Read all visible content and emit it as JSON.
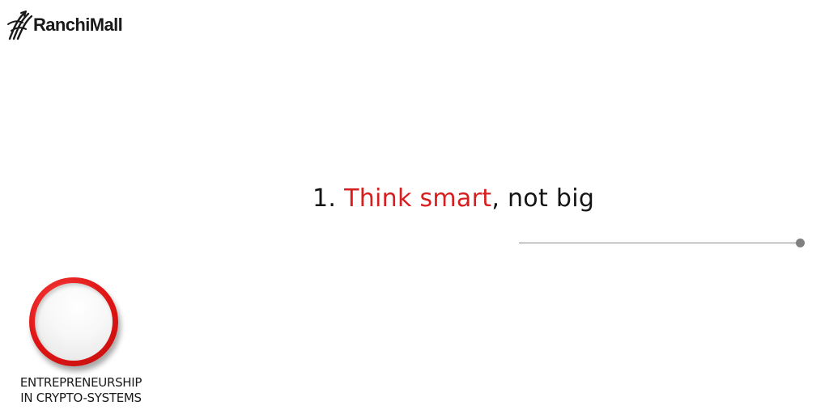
{
  "brand": {
    "name": "RanchiMall",
    "logo_icon": "ranchimall-swoosh-icon"
  },
  "headline": {
    "number": "1.",
    "accent": "Think smart",
    "rest": ", not big"
  },
  "badge": {
    "line1": "ENTREPRENEURSHIP",
    "line2": "IN CRYPTO-SYSTEMS"
  },
  "colors": {
    "accent": "#d81f20",
    "text": "#141414",
    "divider": "#8a8a8a"
  }
}
